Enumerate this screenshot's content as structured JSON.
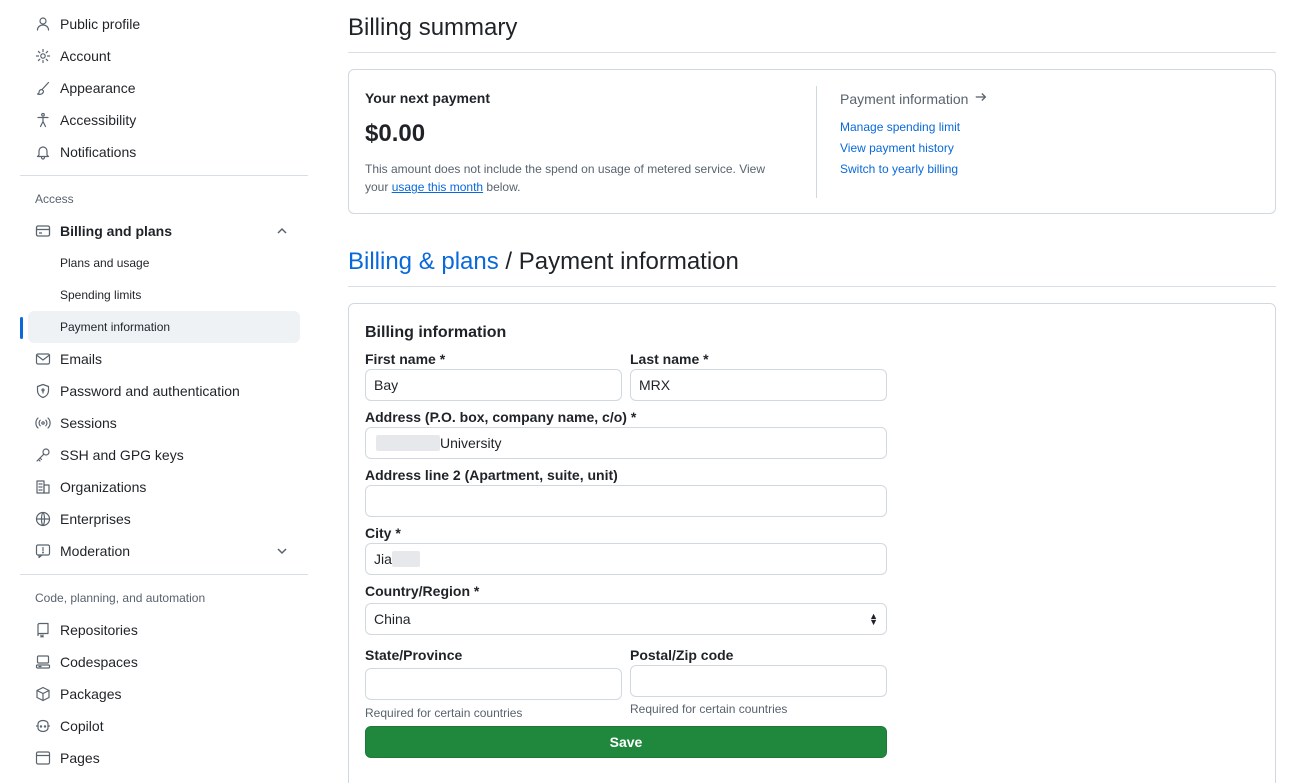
{
  "sidebar": {
    "top_items": [
      {
        "label": "Public profile",
        "icon": "person-icon"
      },
      {
        "label": "Account",
        "icon": "gear-icon"
      },
      {
        "label": "Appearance",
        "icon": "paintbrush-icon"
      },
      {
        "label": "Accessibility",
        "icon": "accessibility-icon"
      },
      {
        "label": "Notifications",
        "icon": "bell-icon"
      }
    ],
    "access_label": "Access",
    "billing": {
      "label": "Billing and plans",
      "icon": "credit-card-icon"
    },
    "billing_sub": [
      "Plans and usage",
      "Spending limits",
      "Payment information"
    ],
    "access_items": [
      {
        "label": "Emails",
        "icon": "mail-icon"
      },
      {
        "label": "Password and authentication",
        "icon": "shield-lock-icon"
      },
      {
        "label": "Sessions",
        "icon": "broadcast-icon"
      },
      {
        "label": "SSH and GPG keys",
        "icon": "key-icon"
      },
      {
        "label": "Organizations",
        "icon": "organization-icon"
      },
      {
        "label": "Enterprises",
        "icon": "globe-icon"
      },
      {
        "label": "Moderation",
        "icon": "report-icon"
      }
    ],
    "code_label": "Code, planning, and automation",
    "code_items": [
      {
        "label": "Repositories",
        "icon": "repo-icon"
      },
      {
        "label": "Codespaces",
        "icon": "codespaces-icon"
      },
      {
        "label": "Packages",
        "icon": "package-icon"
      },
      {
        "label": "Copilot",
        "icon": "copilot-icon"
      },
      {
        "label": "Pages",
        "icon": "browser-icon"
      }
    ]
  },
  "summary": {
    "title": "Billing summary",
    "next_payment_label": "Your next payment",
    "amount": "$0.00",
    "note_prefix": "This amount does not include the spend on usage of metered service. View your",
    "note_link": "usage this month",
    "note_suffix": "below.",
    "payment_info_label": "Payment information",
    "links": [
      "Manage spending limit",
      "View payment history",
      "Switch to yearly billing"
    ]
  },
  "breadcrumb": {
    "link": "Billing & plans",
    "separator": "/",
    "current": "Payment information"
  },
  "form": {
    "title": "Billing information",
    "first_name_label": "First name *",
    "first_name_value": "Bay",
    "last_name_label": "Last name *",
    "last_name_value": "MRX",
    "address_label": "Address (P.O. box, company name, c/o) *",
    "address_value": "University",
    "address2_label": "Address line 2 (Apartment, suite, unit)",
    "address2_value": "",
    "city_label": "City *",
    "city_value": "Jia",
    "country_label": "Country/Region *",
    "country_value": "China",
    "state_label": "State/Province",
    "state_value": "",
    "state_hint": "Required for certain countries",
    "postal_label": "Postal/Zip code",
    "postal_value": "",
    "postal_hint": "Required for certain countries",
    "save_label": "Save"
  },
  "colors": {
    "accent": "#0969da",
    "save_green": "#1f883d",
    "active_bg": "#eff2f5"
  }
}
